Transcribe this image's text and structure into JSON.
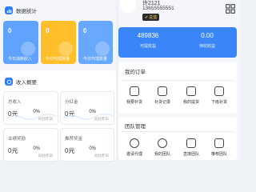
{
  "colors": {
    "accent": "#2f7df6",
    "blue_light": "#5fa3ff",
    "orange": "#ffbf2a",
    "sky": "#68a8ff",
    "badge_bg": "#2c2c2c",
    "badge_text": "#f5d26a"
  },
  "data_stats": {
    "title": "数据统计",
    "icon": "chart-icon",
    "cards": [
      {
        "value": "0",
        "label": "今日消耗收入"
      },
      {
        "value": "0",
        "label": "今日代理数量"
      },
      {
        "value": "0",
        "label": "今日代理数量"
      }
    ]
  },
  "income": {
    "title": "收入概要",
    "icon": "money-icon",
    "cards": [
      {
        "label": "总收入",
        "value": "0元",
        "pct": "0%",
        "compare": "同比昨日"
      },
      {
        "label": "分红金",
        "value": "0元",
        "pct": "0%",
        "compare": "同比昨日"
      },
      {
        "label": "业绩奖励",
        "value": "0元",
        "pct": "0%",
        "compare": "同比昨日"
      },
      {
        "label": "推荐奖金",
        "value": "0元",
        "pct": "0%",
        "compare": "同比昨日"
      }
    ]
  },
  "profile": {
    "name": "许2121",
    "phone": "13655555551",
    "badge": "总监",
    "scan_icon": "scan-icon"
  },
  "balance": {
    "available_value": "489836",
    "available_label": "可提收益",
    "pending_value": "0.00",
    "pending_label": "待收收益"
  },
  "orders": {
    "title": "我的订单",
    "items": [
      {
        "label": "我要补货",
        "icon": "restock-icon"
      },
      {
        "label": "补货记录",
        "icon": "record-icon"
      },
      {
        "label": "我的提货",
        "icon": "pickup-icon"
      },
      {
        "label": "下级补货",
        "icon": "sub-restock-icon"
      }
    ]
  },
  "team": {
    "title": "团队管理",
    "items": [
      {
        "label": "邀请代理",
        "icon": "invite-icon"
      },
      {
        "label": "我的团队",
        "icon": "team-icon"
      },
      {
        "label": "直接团队",
        "icon": "direct-team-icon"
      },
      {
        "label": "推荐团队",
        "icon": "recommend-team-icon"
      }
    ]
  }
}
